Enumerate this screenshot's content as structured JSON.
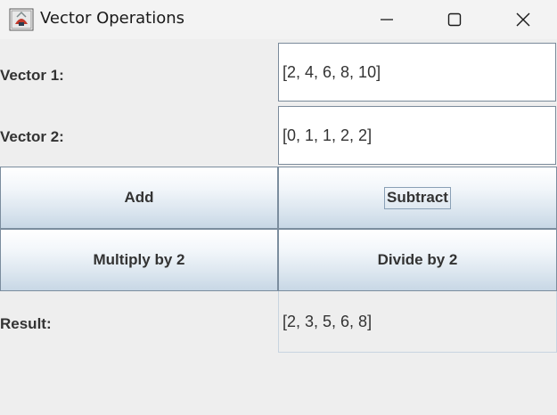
{
  "window": {
    "title": "Vector Operations",
    "icon": "java-app-icon",
    "controls": {
      "minimize": "minimize-icon",
      "maximize": "maximize-icon",
      "close": "close-icon"
    }
  },
  "form": {
    "vector1_label": "Vector 1:",
    "vector1_value": "[2, 4, 6, 8, 10]",
    "vector2_label": "Vector 2:",
    "vector2_value": "[0, 1, 1, 2, 2]",
    "result_label": "Result:",
    "result_value": "[2, 3, 5, 6, 8]"
  },
  "buttons": {
    "add": "Add",
    "subtract": "Subtract",
    "multiply": "Multiply by 2",
    "divide": "Divide by 2"
  }
}
